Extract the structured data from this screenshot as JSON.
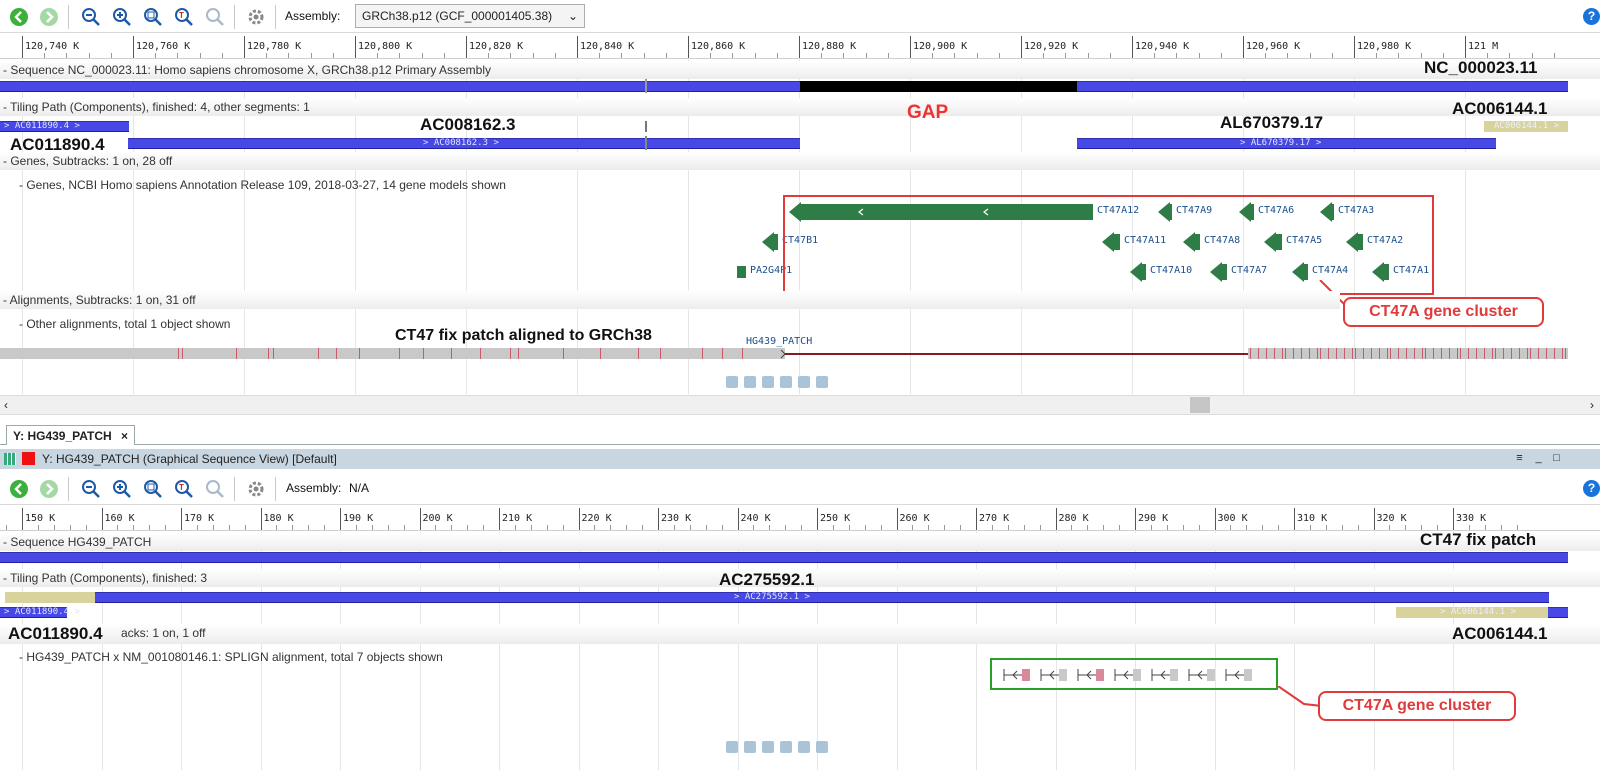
{
  "top_view": {
    "assembly_label": "Assembly:",
    "assembly_value": "GRCh38.p12 (GCF_000001405.38)",
    "ruler_ticks": [
      "120,740 K",
      "120,760 K",
      "120,780 K",
      "120,800 K",
      "120,820 K",
      "120,840 K",
      "120,860 K",
      "120,880 K",
      "120,900 K",
      "120,920 K",
      "120,940 K",
      "120,960 K",
      "120,980 K",
      "121 M"
    ],
    "sequence_track": "- Sequence NC_000023.11: Homo sapiens chromosome X, GRCh38.p12 Primary Assembly",
    "sequence_name": "NC_000023.11",
    "tiling_track": "- Tiling Path (Components), finished: 4, other segments: 1",
    "gap_label": "GAP",
    "components": {
      "ac011890_small": "> AC011890.4 >",
      "ac008162": "> AC008162.3 >",
      "al670379": "> AL670379.17 >",
      "ac006144_small": "AC006144.1 >"
    },
    "big_labels": {
      "ac008162": "AC008162.3",
      "al670379": "AL670379.17",
      "ac006144": "AC006144.1",
      "ac011890": "AC011890.4"
    },
    "genes_track": "- Genes, Subtracks: 1 on, 28 off",
    "genes_subtrack": "- Genes, NCBI Homo sapiens Annotation Release 109, 2018-03-27, 14 gene models shown",
    "genes_row1": [
      "CT47A12",
      "CT47A9",
      "CT47A6",
      "CT47A3"
    ],
    "genes_row2": [
      "CT47B1",
      "CT47A11",
      "CT47A8",
      "CT47A5",
      "CT47A2"
    ],
    "genes_row3": [
      "PA2G4P1",
      "CT47A10",
      "CT47A7",
      "CT47A4",
      "CT47A1"
    ],
    "cluster_callout": "CT47A gene cluster",
    "alignments_track": "- Alignments, Subtracks: 1 on, 31 off",
    "other_alignments": "- Other alignments, total 1 object shown",
    "fix_patch_note": "CT47 fix patch aligned to GRCh38",
    "patch_label": "HG439_PATCH"
  },
  "tab": {
    "label": "Y: HG439_PATCH",
    "close": "×"
  },
  "bottom_view": {
    "title": "Y: HG439_PATCH (Graphical Sequence View) [Default]",
    "assembly_label": "Assembly:",
    "assembly_value": "N/A",
    "ruler_ticks": [
      "150 K",
      "160 K",
      "170 K",
      "180 K",
      "190 K",
      "200 K",
      "210 K",
      "220 K",
      "230 K",
      "240 K",
      "250 K",
      "260 K",
      "270 K",
      "280 K",
      "290 K",
      "300 K",
      "310 K",
      "320 K",
      "330 K"
    ],
    "sequence_track": "- Sequence HG439_PATCH",
    "sequence_name": "CT47 fix patch",
    "tiling_track": "- Tiling Path (Components), finished: 3",
    "components": {
      "ac011890_small": "> AC011890.4 >",
      "ac275592": "> AC275592.1 >",
      "ac006144_small": "> AC006144.1 >"
    },
    "big_labels": {
      "ac275592": "AC275592.1",
      "ac011890": "AC011890.4",
      "ac006144": "AC006144.1"
    },
    "subtracks_fragment": "acks: 1 on, 1 off",
    "splign_track": "- HG439_PATCH x NM_001080146.1: SPLIGN alignment, total 7 objects shown",
    "cluster_callout": "CT47A gene cluster"
  },
  "colors": {
    "component_blue": "#4848e6",
    "gene_green": "#2f7d46",
    "highlight_red": "#e03a3a",
    "highlight_green": "#2aa02a",
    "gap_black": "#000000"
  }
}
